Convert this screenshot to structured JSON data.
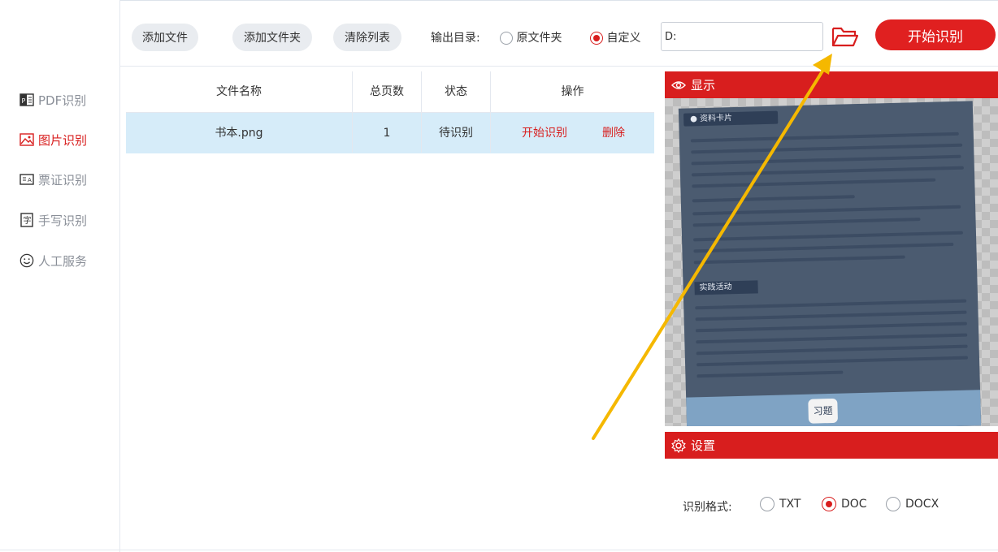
{
  "sidebar": {
    "items": [
      {
        "label": "PDF识别",
        "icon": "pdf-icon",
        "active": false
      },
      {
        "label": "图片识别",
        "icon": "image-icon",
        "active": true
      },
      {
        "label": "票证识别",
        "icon": "ticket-icon",
        "active": false
      },
      {
        "label": "手写识别",
        "icon": "handwriting-icon",
        "active": false
      },
      {
        "label": "人工服务",
        "icon": "smiley-icon",
        "active": false
      }
    ]
  },
  "toolbar": {
    "add_file": "添加文件",
    "add_folder": "添加文件夹",
    "clear_list": "清除列表",
    "output_label": "输出目录:",
    "opt_original": "原文件夹",
    "opt_custom": "自定义",
    "output_value": "D:",
    "start_label": "开始识别"
  },
  "table": {
    "headers": [
      "文件名称",
      "总页数",
      "状态",
      "操作"
    ],
    "rows": [
      {
        "name": "书本.png",
        "pages": "1",
        "status": "待识别",
        "action_start": "开始识别",
        "action_delete": "删除"
      }
    ]
  },
  "preview": {
    "title": "显示",
    "image_tab": "● 资料卡片",
    "image_band": "实践活动",
    "image_foot": "习题"
  },
  "settings": {
    "title": "设置",
    "format_label": "识别格式:",
    "formats": [
      "TXT",
      "DOC",
      "DOCX"
    ],
    "selected": "DOC"
  },
  "colors": {
    "accent": "#d81e1e",
    "selected_row": "#d6ecf9",
    "arrow": "#f5b800"
  }
}
